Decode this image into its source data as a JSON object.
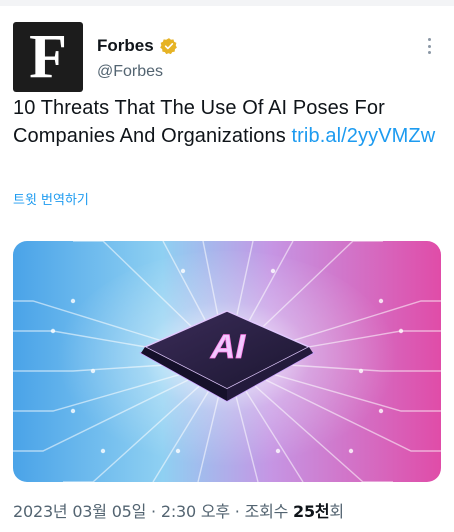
{
  "account": {
    "avatar_letter": "F",
    "display_name": "Forbes",
    "handle": "@Forbes",
    "verified_badge": "verified-gold-icon",
    "brand_color": "#1c1c1c",
    "badge_color": "#e6b325"
  },
  "tweet": {
    "text": "10 Threats That The Use Of AI Poses For Companies And Organizations ",
    "link": "trib.al/2yyVMZw",
    "translate_label": "트윗 번역하기",
    "link_color": "#1d9bf0"
  },
  "media": {
    "chip_label": "AI"
  },
  "meta": {
    "date": "2023년 03월 05일",
    "separator": " · ",
    "time": "2:30 오후",
    "views_label": "조회수 ",
    "views_count": "25천",
    "views_suffix": "회"
  },
  "icons": {
    "more": "more-options-icon"
  }
}
